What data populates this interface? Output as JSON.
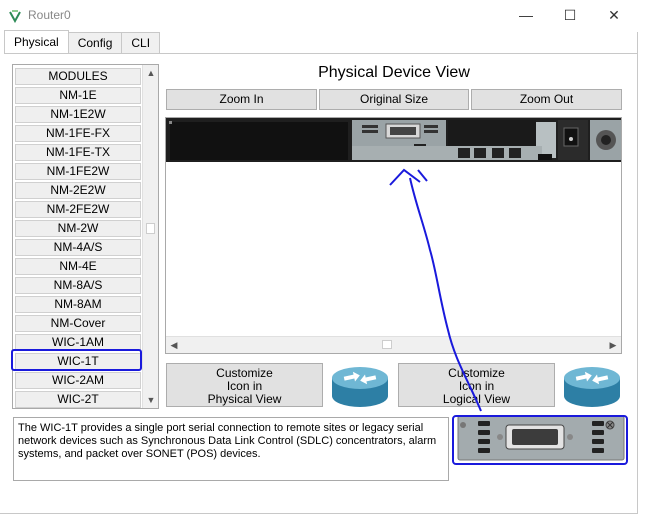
{
  "window": {
    "title": "Router0",
    "controls": {
      "minimize": "—",
      "maximize": "☐",
      "close": "✕"
    }
  },
  "tabs": [
    {
      "label": "Physical",
      "active": true
    },
    {
      "label": "Config",
      "active": false
    },
    {
      "label": "CLI",
      "active": false
    }
  ],
  "modules": {
    "items": [
      "MODULES",
      "NM-1E",
      "NM-1E2W",
      "NM-1FE-FX",
      "NM-1FE-TX",
      "NM-1FE2W",
      "NM-2E2W",
      "NM-2FE2W",
      "NM-2W",
      "NM-4A/S",
      "NM-4E",
      "NM-8A/S",
      "NM-8AM",
      "NM-Cover",
      "WIC-1AM",
      "WIC-1T",
      "WIC-2AM",
      "WIC-2T"
    ],
    "selected": "WIC-1T"
  },
  "device_view": {
    "title": "Physical Device View",
    "zoom_in": "Zoom In",
    "original_size": "Original Size",
    "zoom_out": "Zoom Out"
  },
  "customize": {
    "physical": [
      "Customize",
      "Icon in",
      "Physical View"
    ],
    "logical": [
      "Customize",
      "Icon in",
      "Logical View"
    ]
  },
  "description": "The WIC-1T provides a single port serial connection to remote sites or legacy serial network devices such as Synchronous Data Link Control (SDLC) concentrators, alarm systems, and packet over SONET (POS) devices.",
  "colors": {
    "annotation": "#1a1adc",
    "router_icon": "#3d93b8",
    "chassis": "#2b2b2b",
    "module_panel": "#9aa3a6"
  },
  "icons": {
    "app": "packet-tracer-icon",
    "router": "router-icon",
    "module": "wic-1t-module-icon"
  }
}
